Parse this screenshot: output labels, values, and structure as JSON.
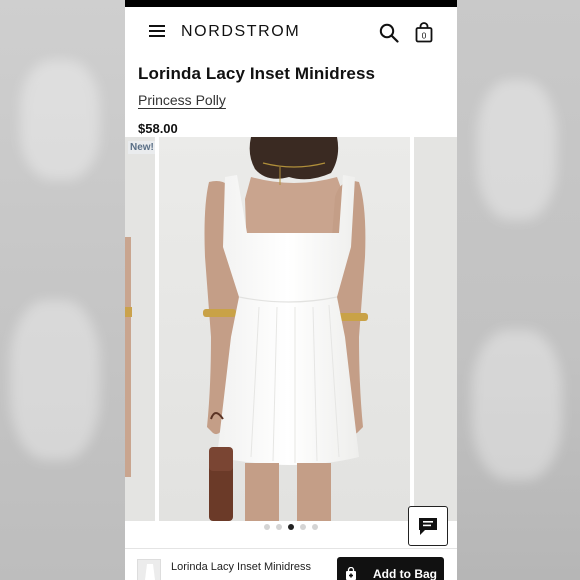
{
  "header": {
    "logo": "NORDSTROM",
    "bag_count": "0"
  },
  "product": {
    "title": "Lorinda Lacy Inset Minidress",
    "brand": "Princess Polly",
    "price": "$58.00"
  },
  "gallery": {
    "badge": "New!",
    "image_count": 5,
    "active_index": 2
  },
  "bottom_bar": {
    "title": "Lorinda Lacy Inset Minidress",
    "add_to_bag_label": "Add to Bag"
  },
  "icons": [
    "menu-icon",
    "search-icon",
    "bag-icon",
    "chat-icon",
    "shopping-bag-icon"
  ]
}
